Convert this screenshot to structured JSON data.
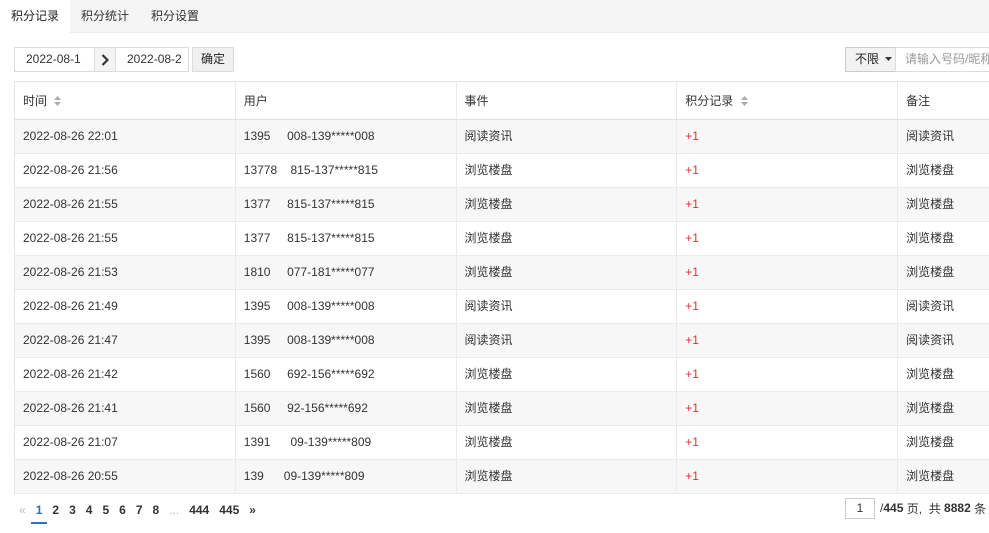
{
  "tabs": [
    {
      "label": "积分记录",
      "active": true
    },
    {
      "label": "积分统计",
      "active": false
    },
    {
      "label": "积分设置",
      "active": false
    }
  ],
  "toolbar": {
    "date_from": "2022-08-1",
    "date_to": "2022-08-2",
    "confirm_label": "确定",
    "filter_value": "不限",
    "search_placeholder": "请输入号码/昵称"
  },
  "table": {
    "headers": [
      "时间",
      "用户",
      "事件",
      "积分记录",
      "备注"
    ],
    "rows": [
      {
        "time": "2022-08-26 22:01",
        "user": "1395     008-139*****008",
        "event": "阅读资讯",
        "score": "+1",
        "note": "阅读资讯"
      },
      {
        "time": "2022-08-26 21:56",
        "user": "13778    815-137*****815",
        "event": "浏览楼盘",
        "score": "+1",
        "note": "浏览楼盘"
      },
      {
        "time": "2022-08-26 21:55",
        "user": "1377     815-137*****815",
        "event": "浏览楼盘",
        "score": "+1",
        "note": "浏览楼盘"
      },
      {
        "time": "2022-08-26 21:55",
        "user": "1377     815-137*****815",
        "event": "浏览楼盘",
        "score": "+1",
        "note": "浏览楼盘"
      },
      {
        "time": "2022-08-26 21:53",
        "user": "1810     077-181*****077",
        "event": "浏览楼盘",
        "score": "+1",
        "note": "浏览楼盘"
      },
      {
        "time": "2022-08-26 21:49",
        "user": "1395     008-139*****008",
        "event": "阅读资讯",
        "score": "+1",
        "note": "阅读资讯"
      },
      {
        "time": "2022-08-26 21:47",
        "user": "1395     008-139*****008",
        "event": "阅读资讯",
        "score": "+1",
        "note": "阅读资讯"
      },
      {
        "time": "2022-08-26 21:42",
        "user": "1560     692-156*****692",
        "event": "浏览楼盘",
        "score": "+1",
        "note": "浏览楼盘"
      },
      {
        "time": "2022-08-26 21:41",
        "user": "1560     92-156*****692",
        "event": "浏览楼盘",
        "score": "+1",
        "note": "浏览楼盘"
      },
      {
        "time": "2022-08-26 21:07",
        "user": "1391      09-139*****809",
        "event": "浏览楼盘",
        "score": "+1",
        "note": "浏览楼盘"
      },
      {
        "time": "2022-08-26 20:55",
        "user": "139      09-139*****809",
        "event": "浏览楼盘",
        "score": "+1",
        "note": "浏览楼盘"
      }
    ]
  },
  "pagination": {
    "prev": "«",
    "pages": [
      "1",
      "2",
      "3",
      "4",
      "5",
      "6",
      "7",
      "8"
    ],
    "ellipsis": "...",
    "tail_pages": [
      "444",
      "445"
    ],
    "next": "»",
    "current_page": "1",
    "info_total_pages": "445",
    "info_total_items": "8882",
    "info_prefix": "/ ",
    "info_pages_suffix": " 页,  共 ",
    "info_items_suffix": " 条"
  },
  "colors": {
    "score": "#e0322f",
    "active_page": "#2a73c2"
  }
}
